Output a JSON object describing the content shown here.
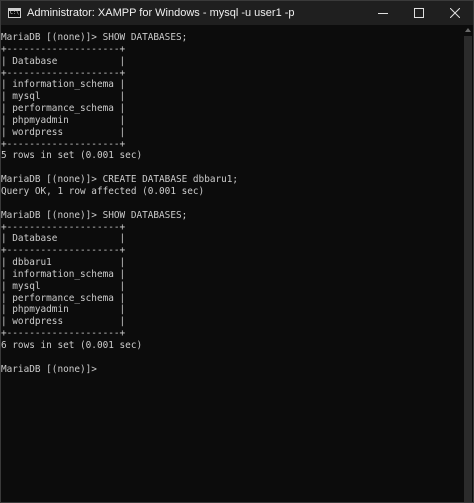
{
  "window": {
    "title": "Administrator:  XAMPP for Windows - mysql  -u user1 -p",
    "icon": "console-icon",
    "icon_glyph": "C:\\"
  },
  "controls": {
    "minimize": "minimize-icon",
    "maximize": "maximize-icon",
    "close": "close-icon"
  },
  "terminal": {
    "lines": [
      "MariaDB [(none)]> SHOW DATABASES;",
      "+--------------------+",
      "| Database           |",
      "+--------------------+",
      "| information_schema |",
      "| mysql              |",
      "| performance_schema |",
      "| phpmyadmin         |",
      "| wordpress          |",
      "+--------------------+",
      "5 rows in set (0.001 sec)",
      "",
      "MariaDB [(none)]> CREATE DATABASE dbbaru1;",
      "Query OK, 1 row affected (0.001 sec)",
      "",
      "MariaDB [(none)]> SHOW DATABASES;",
      "+--------------------+",
      "| Database           |",
      "+--------------------+",
      "| dbbaru1            |",
      "| information_schema |",
      "| mysql              |",
      "| performance_schema |",
      "| phpmyadmin         |",
      "| wordpress          |",
      "+--------------------+",
      "6 rows in set (0.001 sec)",
      "",
      "MariaDB [(none)]>"
    ]
  },
  "colors": {
    "background": "#0c0c0c",
    "text": "#cccccc",
    "titlebar": "#1f1f1f"
  }
}
